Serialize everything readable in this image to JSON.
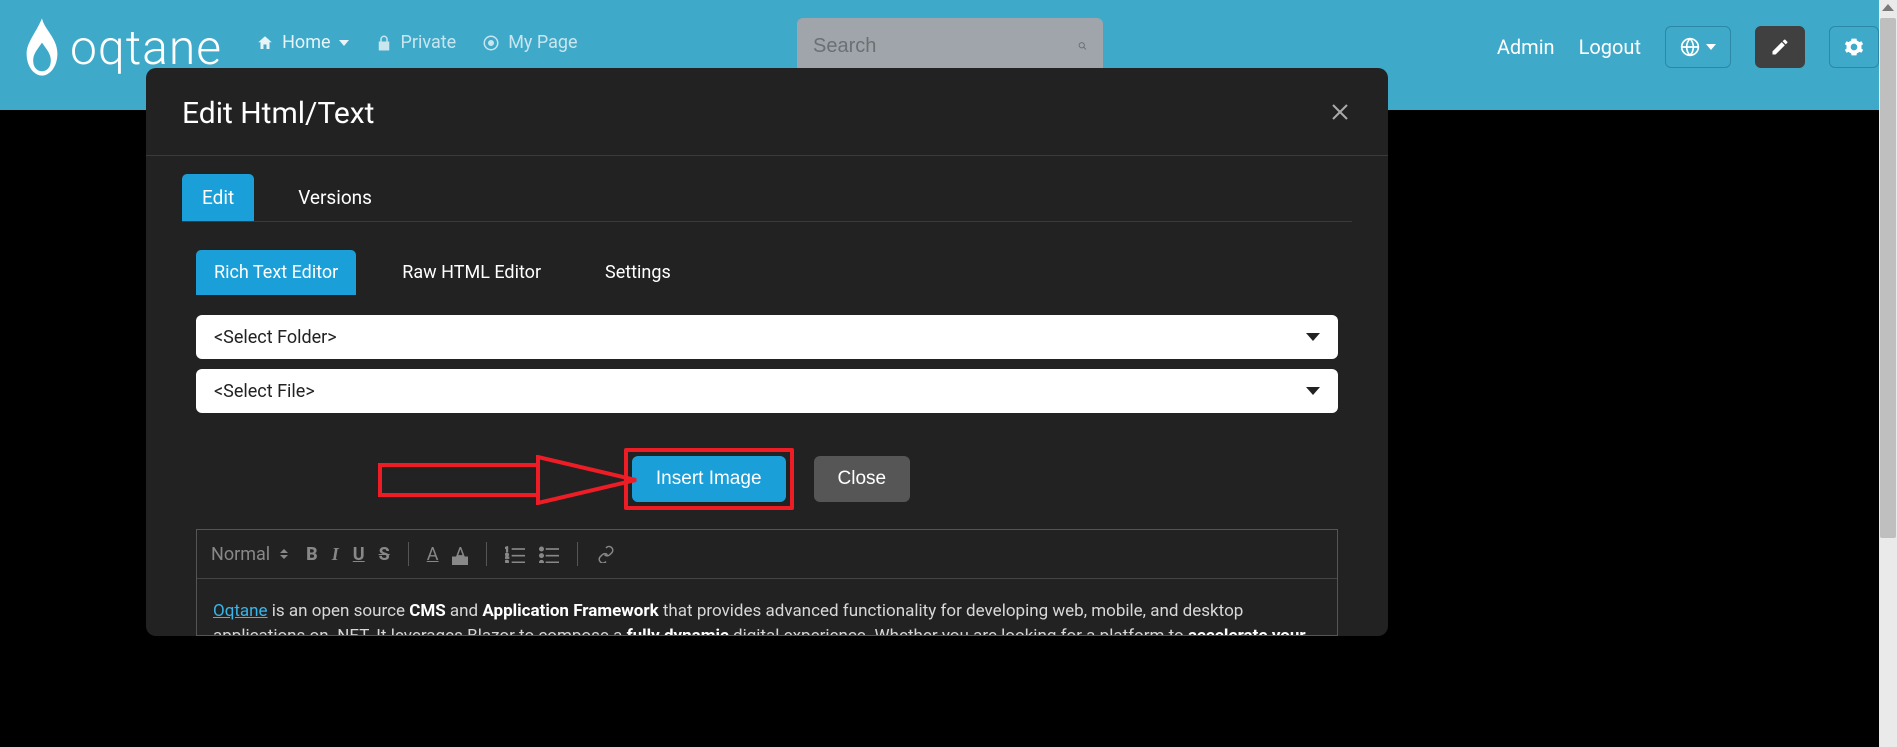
{
  "nav": {
    "brand": "oqtane",
    "home": "Home",
    "private": "Private",
    "mypage": "My Page",
    "search_placeholder": "Search",
    "admin": "Admin",
    "logout": "Logout"
  },
  "modal": {
    "title": "Edit Html/Text",
    "tabs": {
      "edit": "Edit",
      "versions": "Versions"
    },
    "subtabs": {
      "rich": "Rich Text Editor",
      "raw": "Raw HTML Editor",
      "settings": "Settings"
    },
    "folder": "<Select Folder>",
    "file": "<Select File>",
    "insert": "Insert Image",
    "close": "Close"
  },
  "toolbar": {
    "normal": "Normal"
  },
  "content": {
    "link": "Oqtane",
    "seg1": " is an open source ",
    "b1": "CMS",
    "seg2": " and ",
    "b2": "Application Framework",
    "seg3": " that provides advanced functionality for developing web, mobile, and desktop applications on .NET. It leverages Blazor to compose a ",
    "b3": "fully dynamic",
    "seg4": " digital experience. Whether you are looking for a platform to ",
    "b4": "accelerate your web development",
    "seg5": ""
  }
}
